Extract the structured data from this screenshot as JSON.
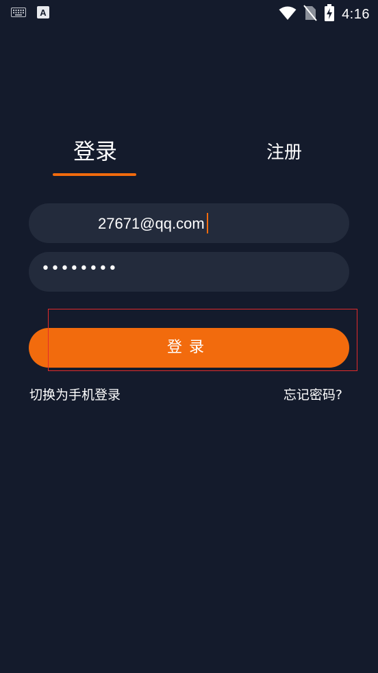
{
  "status_bar": {
    "time": "4:16",
    "icons": [
      "keyboard-icon",
      "a-input-icon",
      "wifi-icon",
      "no-sim-icon",
      "battery-charging-icon"
    ]
  },
  "tabs": {
    "login": "登录",
    "register": "注册"
  },
  "form": {
    "email_value": "27671@qq.com",
    "password_masked": "••••••••"
  },
  "login_button": "登录",
  "links": {
    "switch_to_phone": "切换为手机登录",
    "forgot_password": "忘记密码?"
  },
  "colors": {
    "background": "#141b2c",
    "input_bg": "#232b3c",
    "accent": "#f26b0d",
    "highlight": "#e32b2b"
  }
}
